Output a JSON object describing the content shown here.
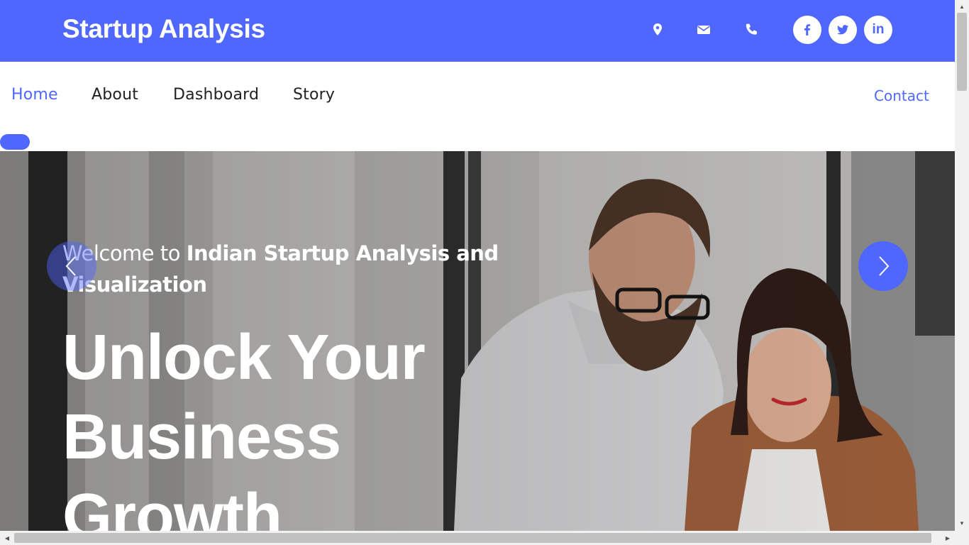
{
  "header": {
    "brand": "Startup Analysis",
    "contact_icons": [
      "map-marker-icon",
      "envelope-icon",
      "phone-icon"
    ],
    "social": [
      {
        "name": "facebook-icon",
        "glyph": "f"
      },
      {
        "name": "twitter-icon",
        "glyph": "t"
      },
      {
        "name": "linkedin-icon",
        "glyph": "in"
      }
    ],
    "bg_color": "#4f67ff"
  },
  "nav": {
    "items": [
      {
        "label": "Home",
        "active": true
      },
      {
        "label": "About",
        "active": false
      },
      {
        "label": "Dashboard",
        "active": false
      },
      {
        "label": "Story",
        "active": false
      }
    ],
    "contact": "Contact",
    "accent": "#4f67ff"
  },
  "hero": {
    "welcome_prefix": "Welcome to ",
    "welcome_bold": "Indian Startup Analysis and Visualization",
    "headline": "Unlock Your Business Growth",
    "prev_icon": "chevron-left-icon",
    "next_icon": "chevron-right-icon"
  }
}
